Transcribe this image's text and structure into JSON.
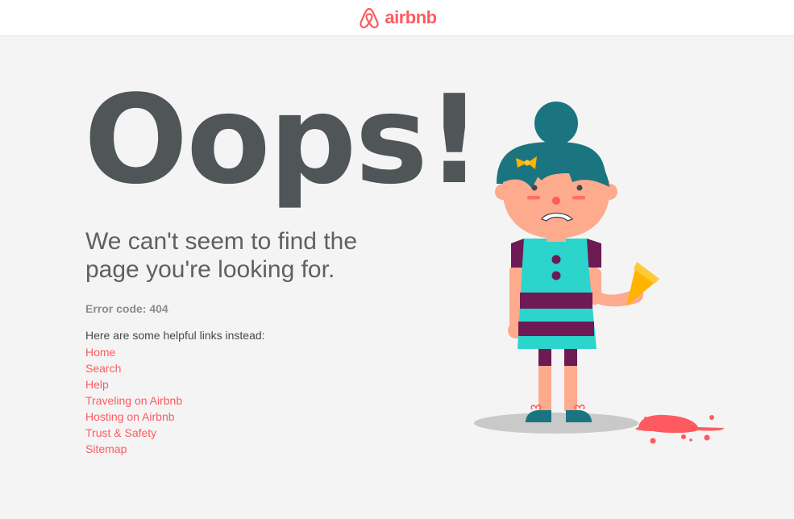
{
  "header": {
    "logo_text": "airbnb",
    "logo_icon": "airbnb-belo-icon"
  },
  "main": {
    "heading": "Oops!",
    "subtitle": "We can't seem to find the page you're looking for.",
    "error_code": "Error code: 404",
    "links_intro": "Here are some helpful links instead:",
    "links": [
      {
        "label": "Home"
      },
      {
        "label": "Search"
      },
      {
        "label": "Help"
      },
      {
        "label": "Traveling on Airbnb"
      },
      {
        "label": "Hosting on Airbnb"
      },
      {
        "label": "Trust & Safety"
      },
      {
        "label": "Sitemap"
      }
    ]
  },
  "illustration": {
    "name": "sad-girl-dropped-ice-cream-icon"
  },
  "colors": {
    "brand": "#ff5a5f",
    "heading": "#505557",
    "text": "#5c6163",
    "background": "#f4f4f4",
    "teal": "#1a7580",
    "dress": "#2bd5cc",
    "purple": "#6d1a55",
    "skin": "#fdaa8d"
  }
}
